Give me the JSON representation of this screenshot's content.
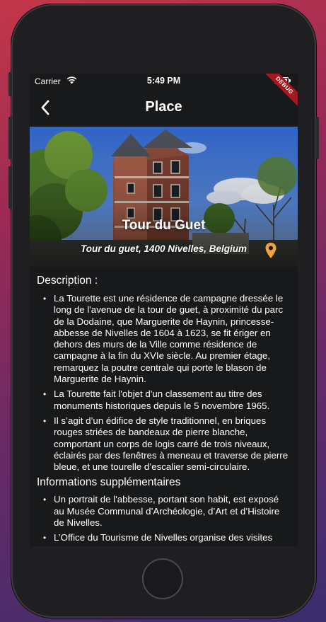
{
  "status_bar": {
    "carrier": "Carrier",
    "time": "5:49 PM",
    "battery_level": 0.95,
    "debug_banner": "DEBUG"
  },
  "app_bar": {
    "title": "Place",
    "back_icon": "chevron-left-icon"
  },
  "hero": {
    "name": "Tour du Guet",
    "address": "Tour du guet, 1400 Nivelles, Belgium",
    "pin_icon": "location-pin-icon",
    "pin_color": "#f2a13b"
  },
  "description": {
    "heading": "Description :",
    "items": [
      "La Tourette est une résidence de campagne dressée le long de l'avenue de la tour de guet, à proximité du parc de la Dodaine,  que Marguerite de Haynin, princesse-abbesse de Nivelles de 1604 à 1623, se fit ériger en dehors des murs de la Ville comme résidence de campagne à la fin du XVIe siècle. Au premier étage, remarquez la poutre centrale qui porte le blason de Marguerite de Haynin.",
      "La Tourette fait l'objet d'un classement au titre des monuments historiques depuis le 5 novembre 1965.",
      "Il s’agit d’un édifice de style traditionnel, en briques rouges striées de bandeaux de pierre blanche, comportant un corps de logis carré de trois niveaux, éclairés par des fenêtres à meneau et traverse de pierre bleue, et une tourelle d’escalier semi-circulaire."
    ]
  },
  "extra_info": {
    "heading": "Informations supplémentaires",
    "items": [
      "Un portrait de l'abbesse, portant son habit, est exposé au Musée Communal d’Archéologie, d’Art et d’Histoire de Nivelles.",
      "L’Office du Tourisme de Nivelles organise des visites"
    ]
  },
  "colors": {
    "screen_background": "#18191b",
    "text": "#ffffff",
    "debug_ribbon": "#a3191f"
  }
}
